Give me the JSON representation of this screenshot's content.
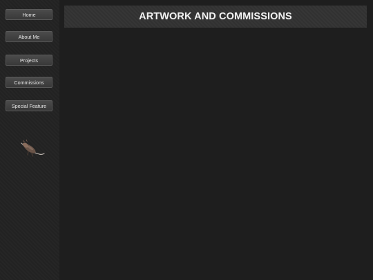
{
  "sidebar": {
    "items": [
      {
        "label": "Home"
      },
      {
        "label": "About Me"
      },
      {
        "label": "Projects"
      },
      {
        "label": "Commissions"
      },
      {
        "label": "Special Feature"
      }
    ],
    "mascot_icon": "animal-figure-icon"
  },
  "header": {
    "title": "ARTWORK AND COMMISSIONS"
  },
  "colors": {
    "page_background": "#1e1e1e",
    "sidebar_background": "#232323",
    "header_background": "#323232",
    "button_background": "#444444",
    "text": "#f2f2f2"
  }
}
